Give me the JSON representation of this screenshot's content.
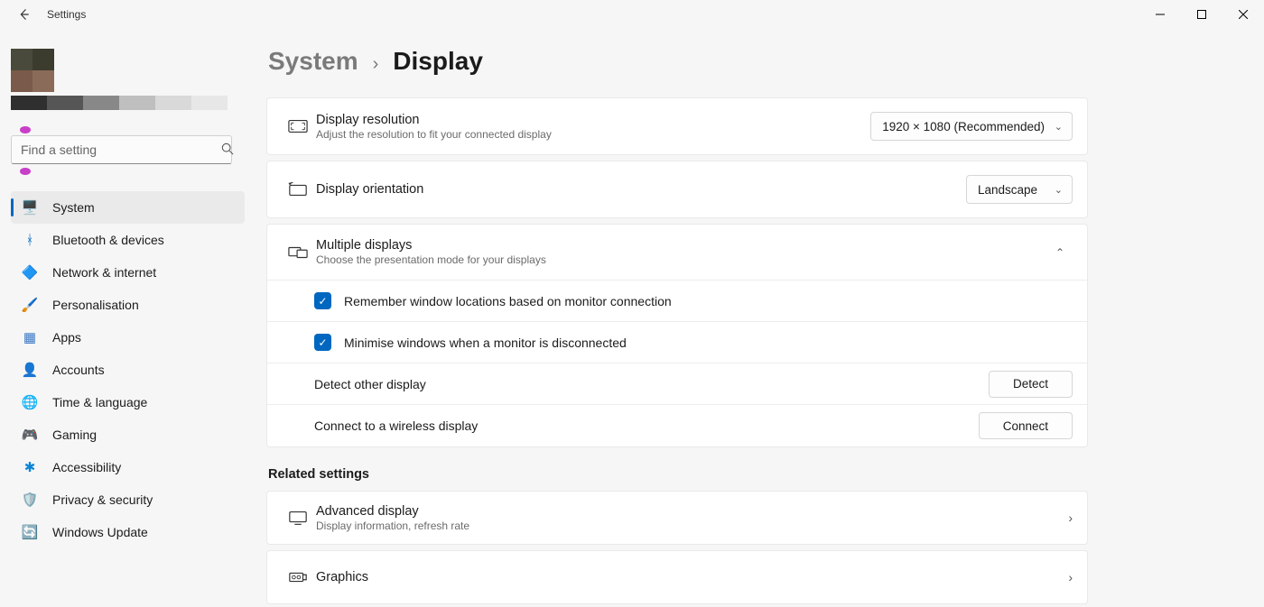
{
  "titlebar": {
    "title": "Settings"
  },
  "search": {
    "placeholder": "Find a setting"
  },
  "nav": [
    {
      "label": "System",
      "icon": "🖥️",
      "name": "system",
      "active": true
    },
    {
      "label": "Bluetooth & devices",
      "icon": "ᚼ",
      "name": "bluetooth",
      "color": "#0067c0"
    },
    {
      "label": "Network & internet",
      "icon": "🔷",
      "name": "network"
    },
    {
      "label": "Personalisation",
      "icon": "🖌️",
      "name": "personalisation"
    },
    {
      "label": "Apps",
      "icon": "▦",
      "name": "apps",
      "color": "#3b78c4"
    },
    {
      "label": "Accounts",
      "icon": "👤",
      "name": "accounts",
      "color": "#2e9e5b"
    },
    {
      "label": "Time & language",
      "icon": "🌐",
      "name": "time-language",
      "color": "#1aa0c9"
    },
    {
      "label": "Gaming",
      "icon": "🎮",
      "name": "gaming",
      "color": "#888"
    },
    {
      "label": "Accessibility",
      "icon": "✱",
      "name": "accessibility",
      "color": "#0a84d6"
    },
    {
      "label": "Privacy & security",
      "icon": "🛡️",
      "name": "privacy",
      "color": "#888"
    },
    {
      "label": "Windows Update",
      "icon": "🔄",
      "name": "update",
      "color": "#0a84d6"
    }
  ],
  "breadcrumb": {
    "parent": "System",
    "current": "Display"
  },
  "resolution": {
    "title": "Display resolution",
    "sub": "Adjust the resolution to fit your connected display",
    "value": "1920 × 1080 (Recommended)"
  },
  "orientation": {
    "title": "Display orientation",
    "value": "Landscape"
  },
  "multi": {
    "title": "Multiple displays",
    "sub": "Choose the presentation mode for your displays",
    "remember": "Remember window locations based on monitor connection",
    "minimise": "Minimise windows when a monitor is disconnected",
    "detect_label": "Detect other display",
    "detect_btn": "Detect",
    "connect_label": "Connect to a wireless display",
    "connect_btn": "Connect"
  },
  "related": {
    "heading": "Related settings",
    "advanced": {
      "title": "Advanced display",
      "sub": "Display information, refresh rate"
    },
    "graphics": {
      "title": "Graphics"
    }
  }
}
